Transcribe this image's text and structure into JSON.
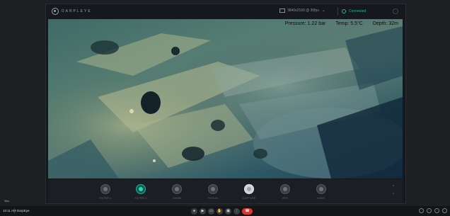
{
  "topbar": {
    "app_name": "DARPLEYE",
    "resolution": "3840x2160 @ 30fps",
    "status": "Connected"
  },
  "video": {
    "hud": {
      "pressure": "Pressure: 1.22 bar",
      "temp": "Temp: 5.5°C",
      "depth": "Depth: 32m"
    }
  },
  "controls": {
    "items": [
      {
        "label": "FILTER 1",
        "state": "inactive"
      },
      {
        "label": "FILTER 2",
        "state": "active"
      },
      {
        "label": "ZOOM",
        "state": "inactive"
      },
      {
        "label": "FOCUS",
        "state": "inactive"
      },
      {
        "label": "CAPTURE",
        "state": "light"
      },
      {
        "label": "IRIS",
        "state": "inactive"
      },
      {
        "label": "LIGHT",
        "state": "inactive"
      }
    ],
    "up_arrow": "⌃",
    "down_arrow": "⌄"
  },
  "caption": "You",
  "meeting_bar": {
    "time": "10:11 AM",
    "meeting_name": "DarpEye",
    "buttons": [
      {
        "icon": "mic-icon",
        "glyph": "●"
      },
      {
        "icon": "camera-icon",
        "glyph": "▶"
      },
      {
        "icon": "captions-icon",
        "glyph": "▭"
      },
      {
        "icon": "raise-hand-icon",
        "glyph": "✋"
      },
      {
        "icon": "present-icon",
        "glyph": "▣"
      },
      {
        "icon": "more-icon",
        "glyph": "⋮"
      }
    ],
    "end_call_glyph": "☎",
    "right_icons": [
      "info-icon",
      "people-icon",
      "chat-icon",
      "activities-icon"
    ]
  },
  "colors": {
    "accent": "#2bb89a",
    "end_call": "#d93a30",
    "background": "#1e1f22"
  }
}
